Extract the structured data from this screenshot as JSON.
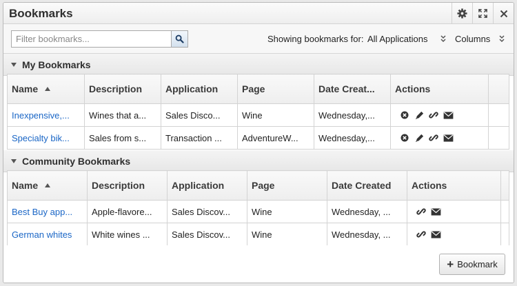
{
  "panel": {
    "title": "Bookmarks",
    "buttons": [
      "gear-icon",
      "expand-icon",
      "close-icon"
    ]
  },
  "toolbar": {
    "filter_placeholder": "Filter bookmarks...",
    "showing_label": "Showing bookmarks for:",
    "showing_value": "All Applications",
    "columns_label": "Columns"
  },
  "my_bookmarks": {
    "title": "My Bookmarks",
    "columns": [
      "Name",
      "Description",
      "Application",
      "Page",
      "Date Creat...",
      "Actions"
    ],
    "rows": [
      {
        "name": "Inexpensive,...",
        "description": "Wines that a...",
        "application": "Sales Disco...",
        "page": "Wine",
        "date": "Wednesday,..."
      },
      {
        "name": "Specialty bik...",
        "description": "Sales from s...",
        "application": "Transaction ...",
        "page": "AdventureW...",
        "date": "Wednesday,..."
      }
    ],
    "actions": [
      "delete-icon",
      "edit-icon",
      "link-icon",
      "email-icon"
    ]
  },
  "community_bookmarks": {
    "title": "Community Bookmarks",
    "columns": [
      "Name",
      "Description",
      "Application",
      "Page",
      "Date Created",
      "Actions"
    ],
    "rows": [
      {
        "name": "Best Buy app...",
        "description": "Apple-flavore...",
        "application": "Sales Discov...",
        "page": "Wine",
        "date": "Wednesday, ..."
      },
      {
        "name": "German whites",
        "description": "White wines ...",
        "application": "Sales Discov...",
        "page": "Wine",
        "date": "Wednesday, ..."
      }
    ],
    "actions": [
      "link-icon",
      "email-icon"
    ]
  },
  "footer": {
    "add_bookmark_label": "Bookmark"
  },
  "colors": {
    "link": "#1a66c6",
    "border": "#d3d3d3",
    "header_bg": "#eeeeee"
  }
}
